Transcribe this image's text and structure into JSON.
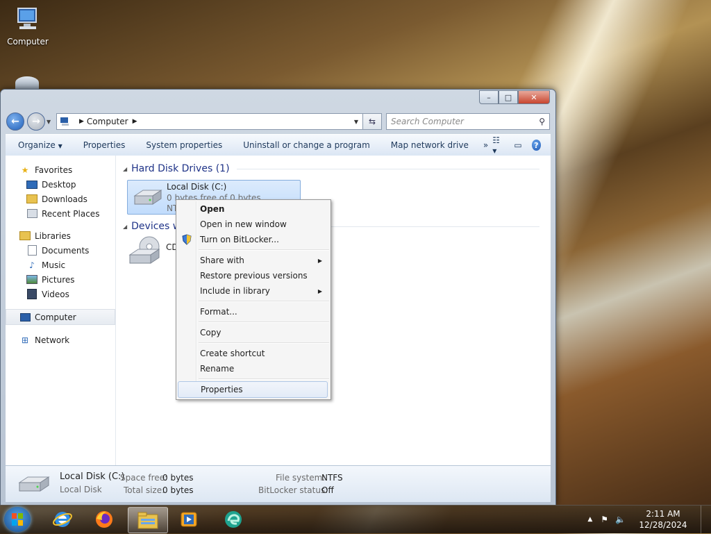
{
  "desktop": {
    "computer_label": "Computer"
  },
  "window": {
    "controls": {
      "minimize": "–",
      "maximize": "□",
      "close": "✕"
    },
    "address": {
      "path": "Computer"
    },
    "search": {
      "placeholder": "Search Computer"
    },
    "toolbar": {
      "organize": "Organize",
      "properties": "Properties",
      "system_properties": "System properties",
      "uninstall": "Uninstall or change a program",
      "map_drive": "Map network drive",
      "more": "»"
    },
    "nav": {
      "favorites": "Favorites",
      "desktop": "Desktop",
      "downloads": "Downloads",
      "recent": "Recent Places",
      "libraries": "Libraries",
      "documents": "Documents",
      "music": "Music",
      "pictures": "Pictures",
      "videos": "Videos",
      "computer": "Computer",
      "network": "Network"
    },
    "groups": {
      "hdd": "Hard Disk Drives (1)",
      "devices": "Devices w"
    },
    "drive": {
      "name": "Local Disk (C:)",
      "free": "0 bytes free of 0 bytes",
      "fs": "NTFS"
    },
    "cd_label": "CD",
    "status": {
      "name": "Local Disk (C:)",
      "type": "Local Disk",
      "space_free_label": "Space free:",
      "space_free": "0 bytes",
      "total_size_label": "Total size:",
      "total_size": "0 bytes",
      "fs_label": "File system:",
      "fs": "NTFS",
      "bitlocker_label": "BitLocker status:",
      "bitlocker": "Off"
    }
  },
  "context_menu": {
    "open": "Open",
    "open_new_window": "Open in new window",
    "bitlocker": "Turn on BitLocker...",
    "share_with": "Share with",
    "restore": "Restore previous versions",
    "include_library": "Include in library",
    "format": "Format...",
    "copy": "Copy",
    "create_shortcut": "Create shortcut",
    "rename": "Rename",
    "properties": "Properties"
  },
  "taskbar": {
    "time": "2:11 AM",
    "date": "12/28/2024"
  }
}
